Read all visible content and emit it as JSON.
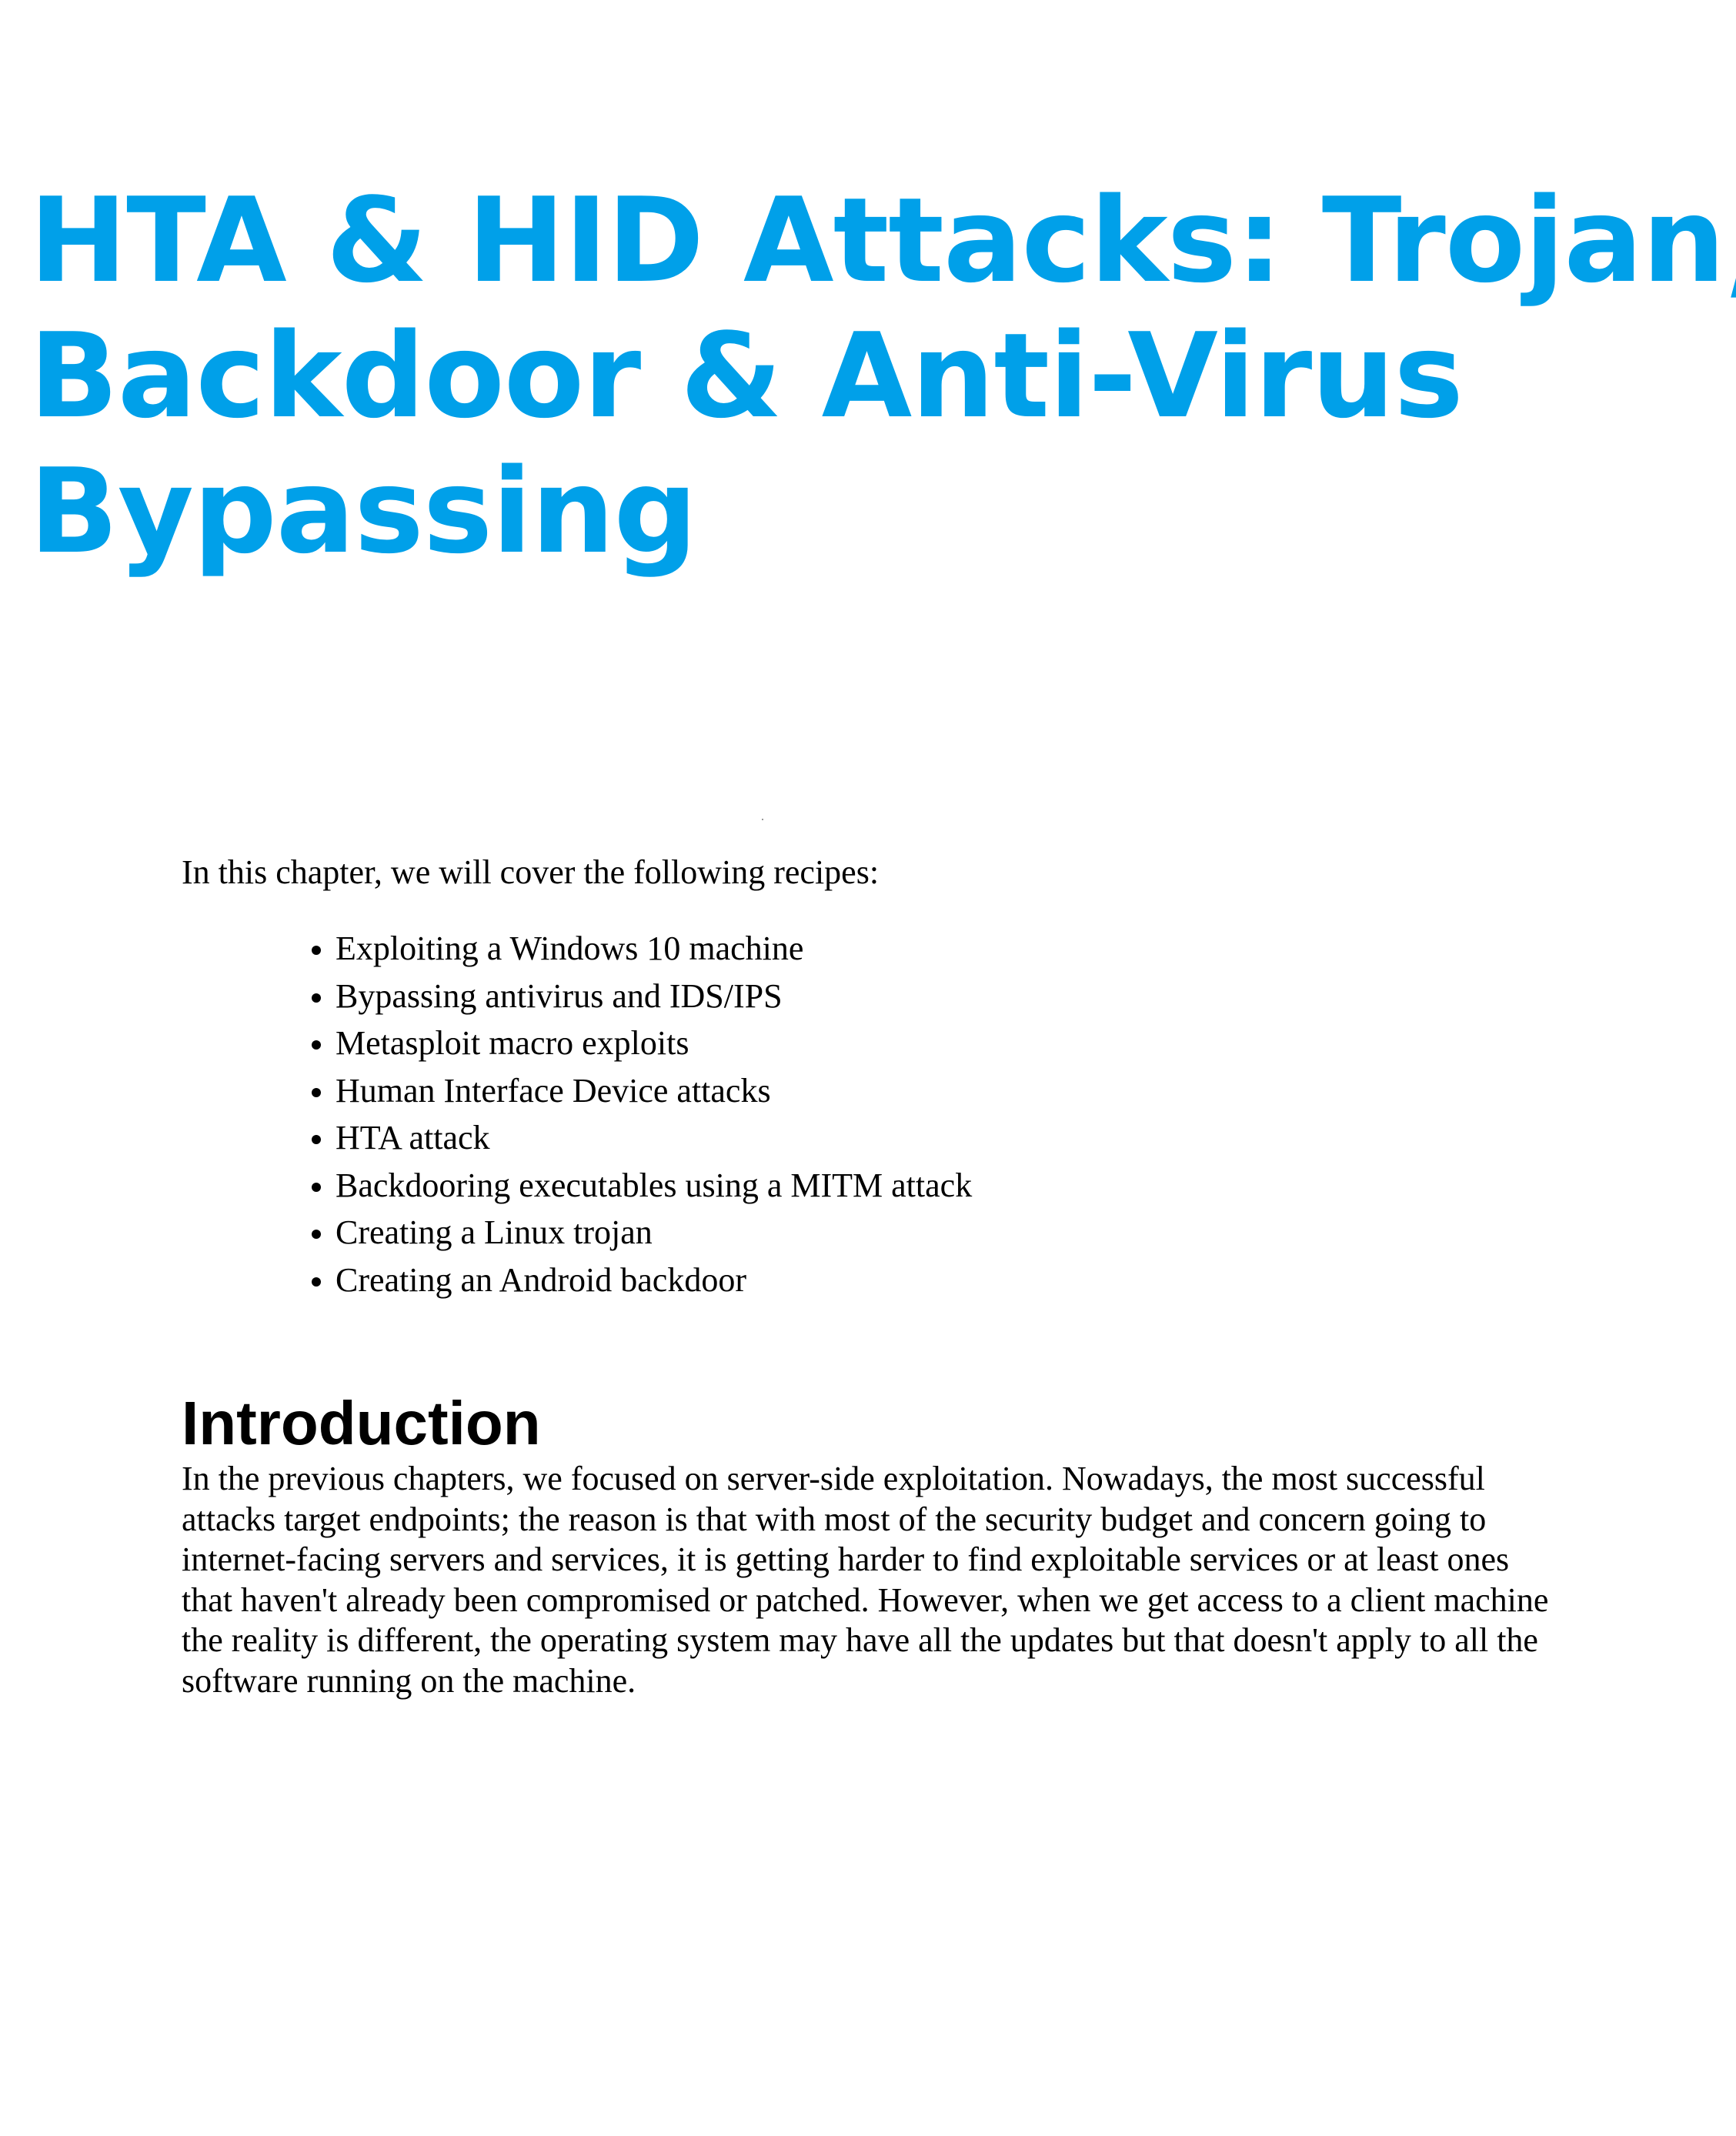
{
  "chapter": {
    "title_lines": [
      "HTA & HID Attacks: Trojan,",
      "Backdoor & Anti-Virus",
      "Bypassing"
    ],
    "title_color": "#00a0e9"
  },
  "recipes": {
    "intro": "In this chapter, we will cover the following recipes:",
    "items": [
      "Exploiting a Windows 10 machine",
      "Bypassing antivirus and IDS/IPS",
      "Metasploit macro exploits",
      "Human Interface Device attacks",
      "HTA attack",
      "Backdooring executables using a MITM attack",
      "Creating a Linux trojan",
      "Creating an Android backdoor"
    ]
  },
  "introduction": {
    "heading": "Introduction",
    "paragraph": "In the previous chapters, we focused on server-side exploitation. Nowadays, the most successful attacks target endpoints; the reason is that with most of the security budget and concern going to internet-facing servers and services, it is getting harder to find exploitable services or at least ones that haven't already been compromised or patched. However, when we get access to a client machine the reality is different, the operating system may have all the updates but that doesn't apply to all the software running on the machine."
  }
}
